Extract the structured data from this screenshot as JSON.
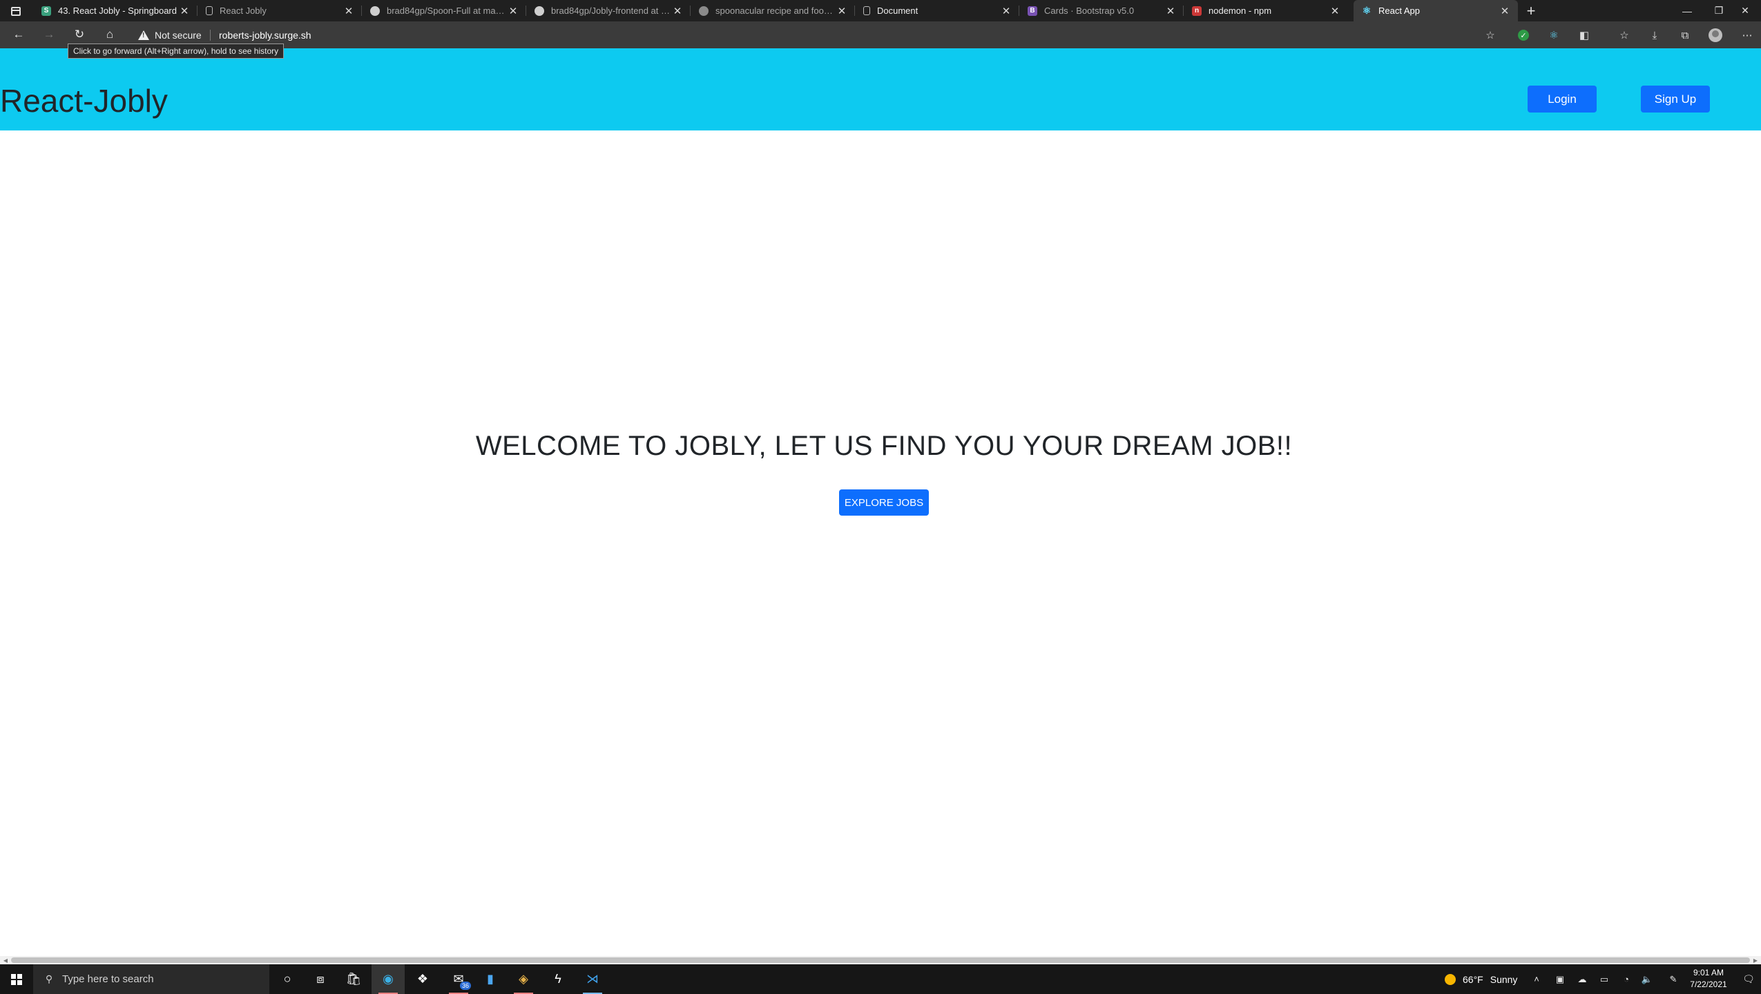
{
  "browser": {
    "tabs": [
      {
        "title": "43. React Jobly - Springboard",
        "icon": "springboard-icon",
        "active": false
      },
      {
        "title": "React Jobly",
        "icon": "page-icon",
        "active": false
      },
      {
        "title": "brad84gp/Spoon-Full at master",
        "icon": "github-icon",
        "active": false
      },
      {
        "title": "brad84gp/Jobly-frontend at master",
        "icon": "github-icon",
        "active": false
      },
      {
        "title": "spoonacular recipe and food API",
        "icon": "spoonacular-icon",
        "active": false
      },
      {
        "title": "Document",
        "icon": "page-icon",
        "active": false
      },
      {
        "title": "Cards · Bootstrap v5.0",
        "icon": "bootstrap-icon",
        "active": false
      },
      {
        "title": "nodemon - npm",
        "icon": "npm-icon",
        "active": false
      },
      {
        "title": "React App",
        "icon": "react-icon",
        "active": true
      }
    ],
    "security_label": "Not secure",
    "url": "roberts-jobly.surge.sh",
    "tooltip": "Click to go forward (Alt+Right arrow), hold to see history"
  },
  "navbar": {
    "brand": "React-Jobly",
    "login_label": "Login",
    "signup_label": "Sign Up",
    "background": "#0dcaf0",
    "button_color": "#0d6efd"
  },
  "hero": {
    "title": "WELCOME TO JOBLY, LET US FIND YOU YOUR DREAM JOB!!",
    "cta_label": "EXPLORE JOBS"
  },
  "taskbar": {
    "search_placeholder": "Type here to search",
    "mail_badge": "36",
    "weather_temp": "66°F",
    "weather_desc": "Sunny",
    "time": "9:01 AM",
    "date": "7/22/2021"
  }
}
